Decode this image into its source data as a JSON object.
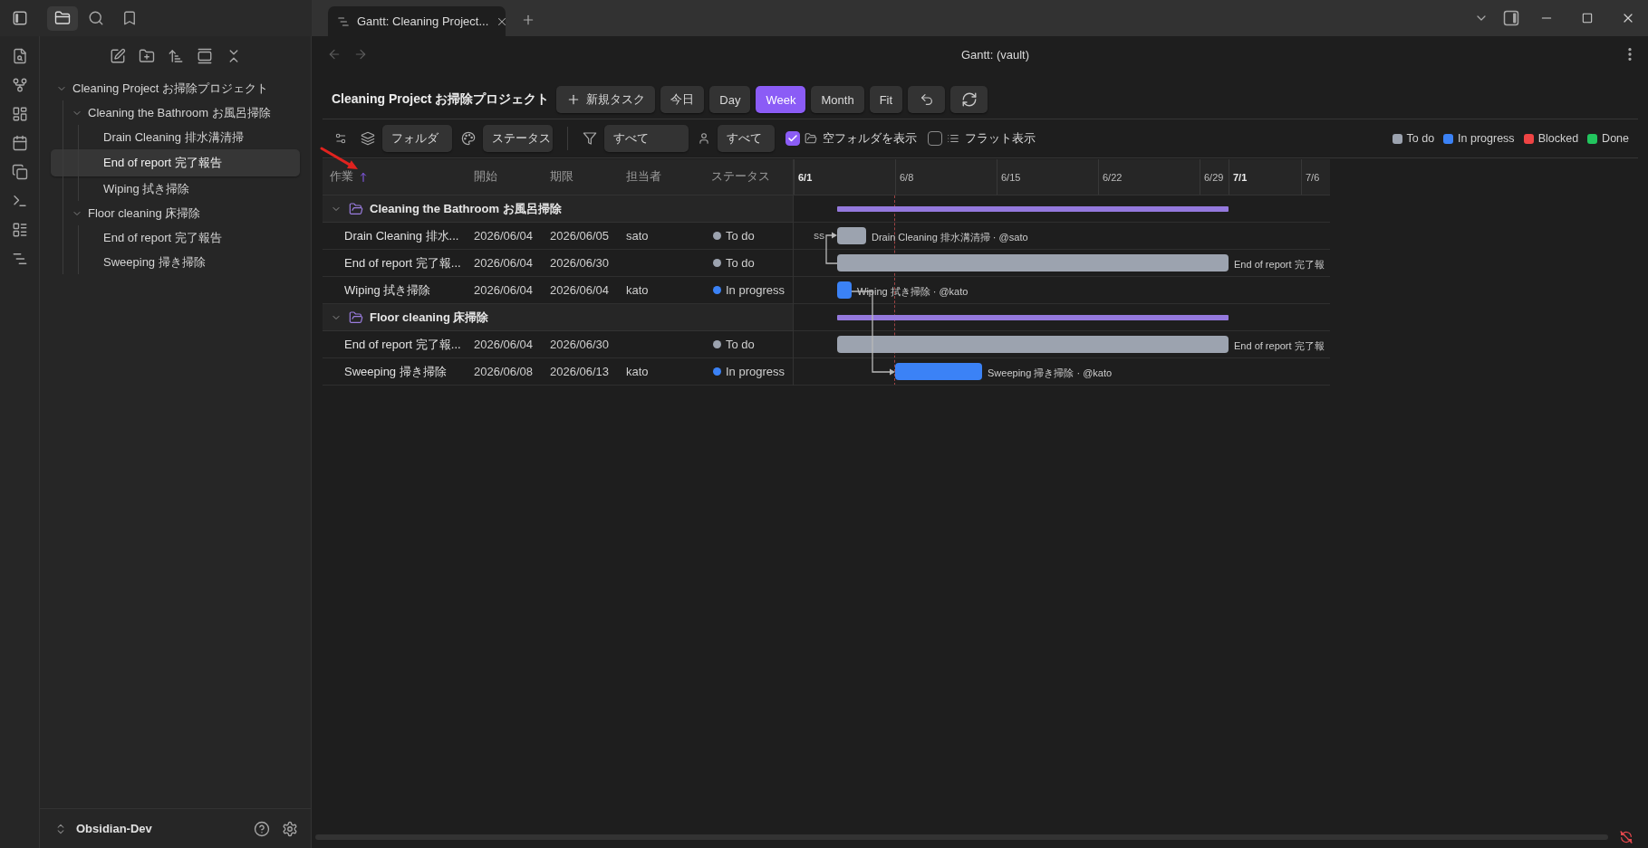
{
  "window": {
    "tab_title": "Gantt: Cleaning Project...",
    "view_title": "Gantt: (vault)"
  },
  "sidebar": {
    "tabs": [
      {
        "kind": "files",
        "selected": true
      },
      {
        "kind": "search",
        "selected": false
      },
      {
        "kind": "bookmarks",
        "selected": false
      }
    ],
    "tree": [
      {
        "label": "Cleaning Project お掃除プロジェクト",
        "expanded": true,
        "selected": false,
        "children": [
          {
            "label": "Cleaning the Bathroom お風呂掃除",
            "expanded": true,
            "selected": false,
            "children": [
              {
                "label": "Drain Cleaning 排水溝清掃",
                "selected": false
              },
              {
                "label": "End of report 完了報告",
                "selected": true
              },
              {
                "label": "Wiping 拭き掃除",
                "selected": false
              }
            ]
          },
          {
            "label": "Floor cleaning 床掃除",
            "expanded": true,
            "selected": false,
            "children": [
              {
                "label": "End of report 完了報告",
                "selected": false
              },
              {
                "label": "Sweeping 掃き掃除",
                "selected": false
              }
            ]
          }
        ]
      }
    ],
    "vault": "Obsidian-Dev"
  },
  "gantt": {
    "title": "Cleaning Project お掃除プロジェクト",
    "new_task_button": "新規タスク",
    "today_button": "今日",
    "scales": [
      {
        "label": "Day",
        "selected": false
      },
      {
        "label": "Week",
        "selected": true
      },
      {
        "label": "Month",
        "selected": false
      }
    ],
    "fit_button": "Fit",
    "filters": {
      "group_by": "フォルダ",
      "color_by": "ステータス",
      "status": "すべて",
      "assignee": "すべて",
      "options": [
        {
          "kind": "folder",
          "label": "空フォルダを表示",
          "checked": true
        },
        {
          "kind": "list",
          "label": "フラット表示",
          "checked": false
        }
      ]
    },
    "legend": [
      {
        "label": "To do",
        "color": "#9ca3af"
      },
      {
        "label": "In progress",
        "color": "#3b82f6"
      },
      {
        "label": "Blocked",
        "color": "#ef4444"
      },
      {
        "label": "Done",
        "color": "#22c55e"
      }
    ],
    "columns": [
      {
        "label": "作業",
        "sorted": true
      },
      {
        "label": "開始",
        "sorted": false
      },
      {
        "label": "期限",
        "sorted": false
      },
      {
        "label": "担当者",
        "sorted": false
      },
      {
        "label": "ステータス",
        "sorted": false
      }
    ],
    "groups": [
      {
        "name": "Cleaning the Bathroom お風呂掃除",
        "expanded": true,
        "rows": [
          {
            "task": "Drain Cleaning 排水...",
            "start": "2026/06/04",
            "due": "2026/06/05",
            "assignee": "sato",
            "status": "To do",
            "color": "#9ca3af",
            "bar_label": "Drain Cleaning 排水溝清掃 · @sato"
          },
          {
            "task": "End of report 完了報...",
            "start": "2026/06/04",
            "due": "2026/06/30",
            "status": "To do",
            "color": "#9ca3af",
            "bar_label": "End of report 完了報"
          },
          {
            "task": "Wiping 拭き掃除",
            "start": "2026/06/04",
            "due": "2026/06/04",
            "assignee": "kato",
            "status": "In progress",
            "color": "#3b82f6",
            "bar_label": "Wiping 拭き掃除 · @kato"
          }
        ]
      },
      {
        "name": "Floor cleaning 床掃除",
        "expanded": true,
        "rows": [
          {
            "task": "End of report 完了報...",
            "start": "2026/06/04",
            "due": "2026/06/30",
            "status": "To do",
            "color": "#9ca3af",
            "bar_label": "End of report 完了報"
          },
          {
            "task": "Sweeping 掃き掃除",
            "start": "2026/06/08",
            "due": "2026/06/13",
            "assignee": "kato",
            "status": "In progress",
            "color": "#3b82f6",
            "bar_label": "Sweeping 掃き掃除 · @kato"
          }
        ]
      }
    ],
    "timeline": {
      "ticks": [
        {
          "label": "6/1",
          "month_start": true
        },
        {
          "label": "6/8",
          "month_start": false
        },
        {
          "label": "6/15",
          "month_start": false
        },
        {
          "label": "6/22",
          "month_start": false
        },
        {
          "label": "6/29",
          "month_start": false
        },
        {
          "label": "7/1",
          "month_start": true
        },
        {
          "label": "7/6",
          "month_start": false
        }
      ],
      "link_label": "SS"
    }
  }
}
